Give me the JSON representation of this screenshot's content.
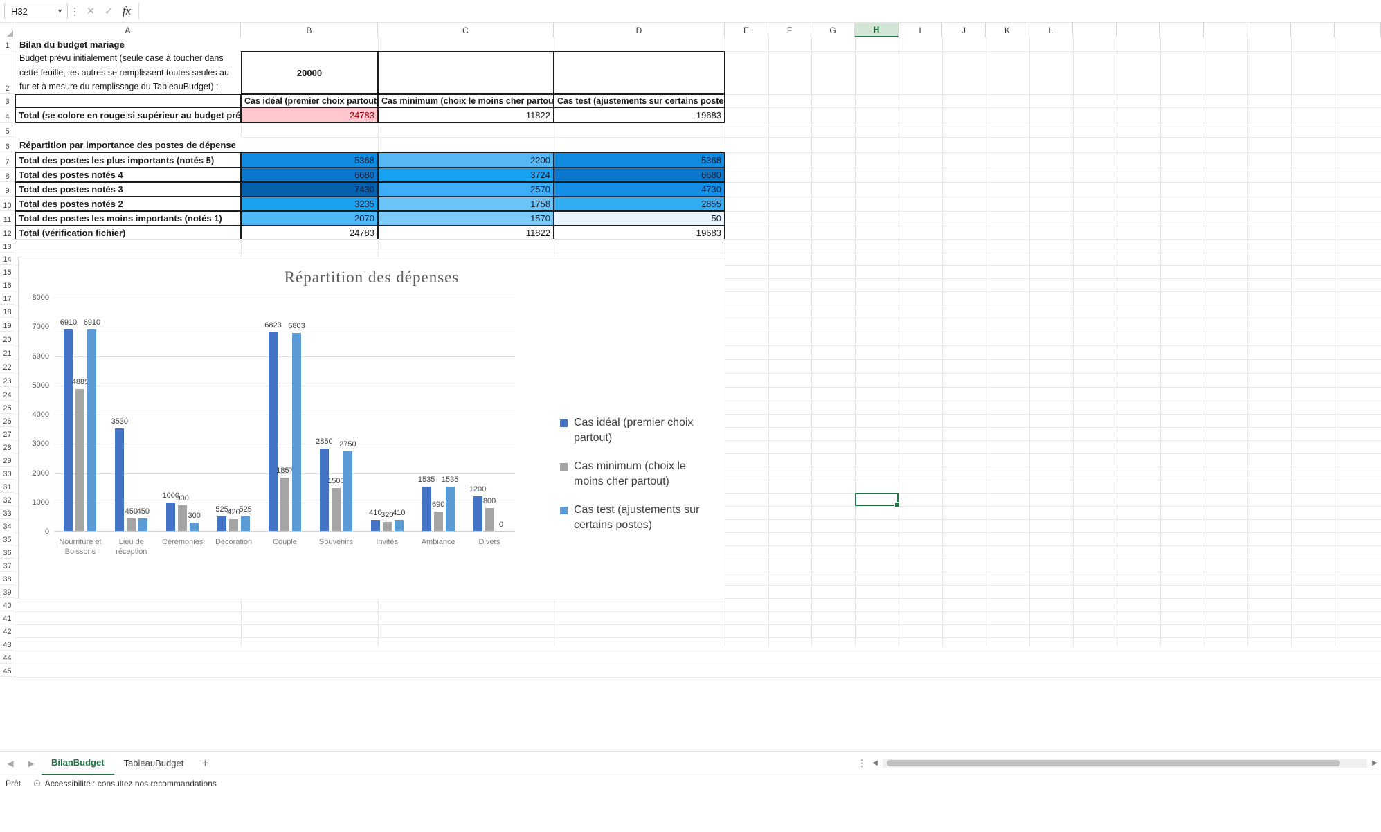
{
  "formula_bar": {
    "name_box_value": "H32",
    "formula_value": "",
    "cancel_icon": "close-icon",
    "accept_icon": "check-icon",
    "function_icon": "fx"
  },
  "columns": [
    "A",
    "B",
    "C",
    "D",
    "E",
    "F",
    "G",
    "H",
    "I",
    "J",
    "K",
    "L"
  ],
  "selected_column": "H",
  "rows": [
    1,
    2,
    3,
    4,
    5,
    6,
    7,
    8,
    9,
    10,
    11,
    12,
    13,
    14,
    15,
    16,
    17,
    18,
    19,
    20,
    21,
    22,
    23,
    24,
    25,
    26,
    27,
    28,
    29,
    30,
    31,
    32,
    33,
    34,
    35,
    36,
    37,
    38,
    39,
    40,
    41,
    42,
    43,
    44,
    45
  ],
  "selected_cell": "H32",
  "sheet": {
    "title": "Bilan du budget mariage",
    "budget_label": "Budget prévu initialement (seule case à toucher dans cette feuille, les autres se remplissent toutes seules au fur et à mesure du remplissage du TableauBudget) :",
    "budget_value": "20000",
    "case_headers": [
      "Cas idéal (premier choix partout)",
      "Cas minimum (choix le moins cher partout)",
      "Cas test (ajustements sur certains postes)"
    ],
    "total_row": {
      "label": "Total (se colore en rouge si supérieur au budget prévu)",
      "values": [
        "24783",
        "11822",
        "19683"
      ]
    },
    "section_title": "Répartition par importance des postes de dépense",
    "breakdown": [
      {
        "label": "Total des postes les plus importants (notés 5)",
        "values": [
          "5368",
          "2200",
          "5368"
        ]
      },
      {
        "label": "Total des postes notés 4",
        "values": [
          "6680",
          "3724",
          "6680"
        ]
      },
      {
        "label": "Total des postes notés 3",
        "values": [
          "7430",
          "2570",
          "4730"
        ]
      },
      {
        "label": "Total des postes notés 2",
        "values": [
          "3235",
          "1758",
          "2855"
        ]
      },
      {
        "label": "Total des postes les moins importants (notés 1)",
        "values": [
          "2070",
          "1570",
          "50"
        ]
      }
    ],
    "verification_row": {
      "label": "Total (vérification fichier)",
      "values": [
        "24783",
        "11822",
        "19683"
      ]
    }
  },
  "chart_data": {
    "type": "bar",
    "title": "Répartition des dépenses",
    "xlabel": "",
    "ylabel": "",
    "ylim": [
      0,
      8000
    ],
    "yticks": [
      0,
      1000,
      2000,
      3000,
      4000,
      5000,
      6000,
      7000,
      8000
    ],
    "grid": true,
    "legend_position": "right",
    "categories": [
      "Nourriture et Boissons",
      "Lieu de réception",
      "Cérémonies",
      "Décoration",
      "Couple",
      "Souvenirs",
      "Invités",
      "Ambiance",
      "Divers"
    ],
    "series": [
      {
        "name": "Cas idéal (premier choix partout)",
        "color": "#4472C4",
        "values": [
          6910,
          3530,
          1000,
          525,
          6823,
          2850,
          410,
          1535,
          1200
        ]
      },
      {
        "name": "Cas minimum (choix le moins cher partout)",
        "color": "#A5A5A5",
        "values": [
          4885,
          450,
          900,
          420,
          1857,
          1500,
          320,
          690,
          800
        ]
      },
      {
        "name": "Cas test (ajustements sur certains postes)",
        "color": "#5B9BD5",
        "values": [
          6910,
          450,
          300,
          525,
          6803,
          2750,
          410,
          1535,
          0
        ]
      }
    ]
  },
  "tabs": {
    "prev_icon": "chevron-left-icon",
    "next_icon": "chevron-right-icon",
    "items": [
      {
        "label": "BilanBudget",
        "active": true
      },
      {
        "label": "TableauBudget",
        "active": false
      }
    ],
    "add_label": "+"
  },
  "status_bar": {
    "ready": "Prêt",
    "accessibility": "Accessibilité : consultez nos recommandations",
    "accessibility_icon": "accessibility-icon"
  },
  "colors": {
    "accent_green": "#217346",
    "over_budget_bg": "#FFC7CE",
    "over_budget_fg": "#9C0006",
    "heat": {
      "row7": [
        "#0F8BE0",
        "#55B8F5",
        "#0F8BE0"
      ],
      "row8": [
        "#0A78CE",
        "#17A2F2",
        "#0A78CE"
      ],
      "row9": [
        "#0560AE",
        "#3DAEF7",
        "#1590E8"
      ],
      "row10": [
        "#1AA2F0",
        "#6CC3F7",
        "#31ADF3"
      ],
      "row11": [
        "#4FB9F7",
        "#7CCBF8",
        "#E8F5FE"
      ]
    }
  }
}
